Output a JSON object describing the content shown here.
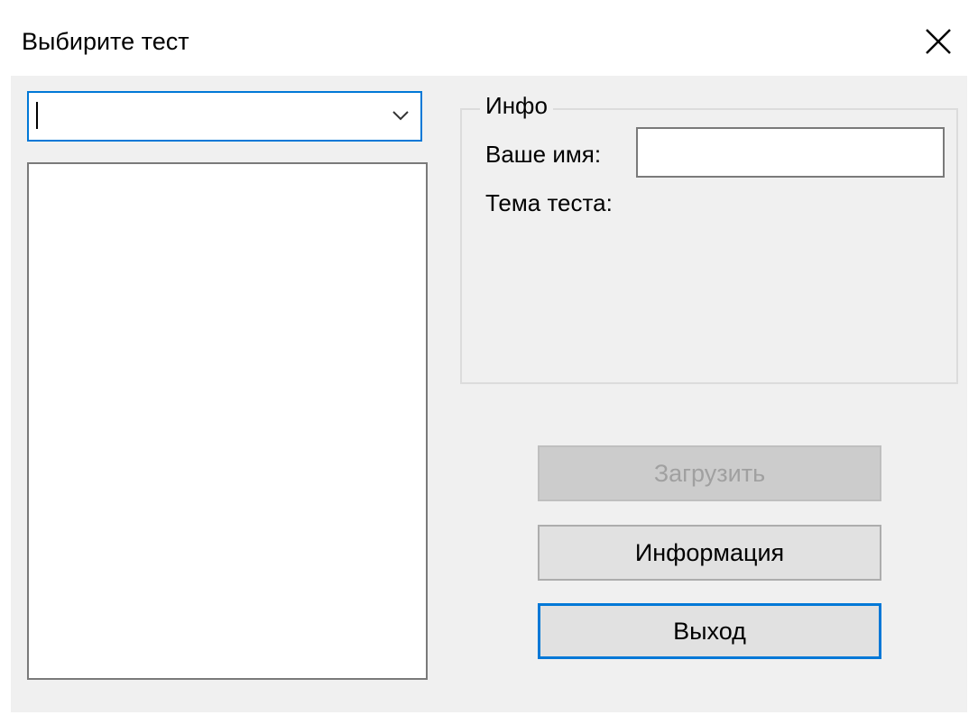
{
  "window": {
    "title": "Выбирите тест",
    "close_icon": "close-icon"
  },
  "test_selector": {
    "value": "",
    "dropdown_icon": "chevron-down-icon"
  },
  "test_list": {
    "items": []
  },
  "info_group": {
    "legend": "Инфо",
    "name_label": "Ваше имя:",
    "name_value": "",
    "topic_label": "Тема теста:"
  },
  "buttons": {
    "load": "Загрузить",
    "load_enabled": false,
    "info": "Информация",
    "exit": "Выход"
  },
  "colors": {
    "window_bg": "#f0f0f0",
    "focus_accent": "#0078d7",
    "disabled_text": "#a0a0a0"
  }
}
